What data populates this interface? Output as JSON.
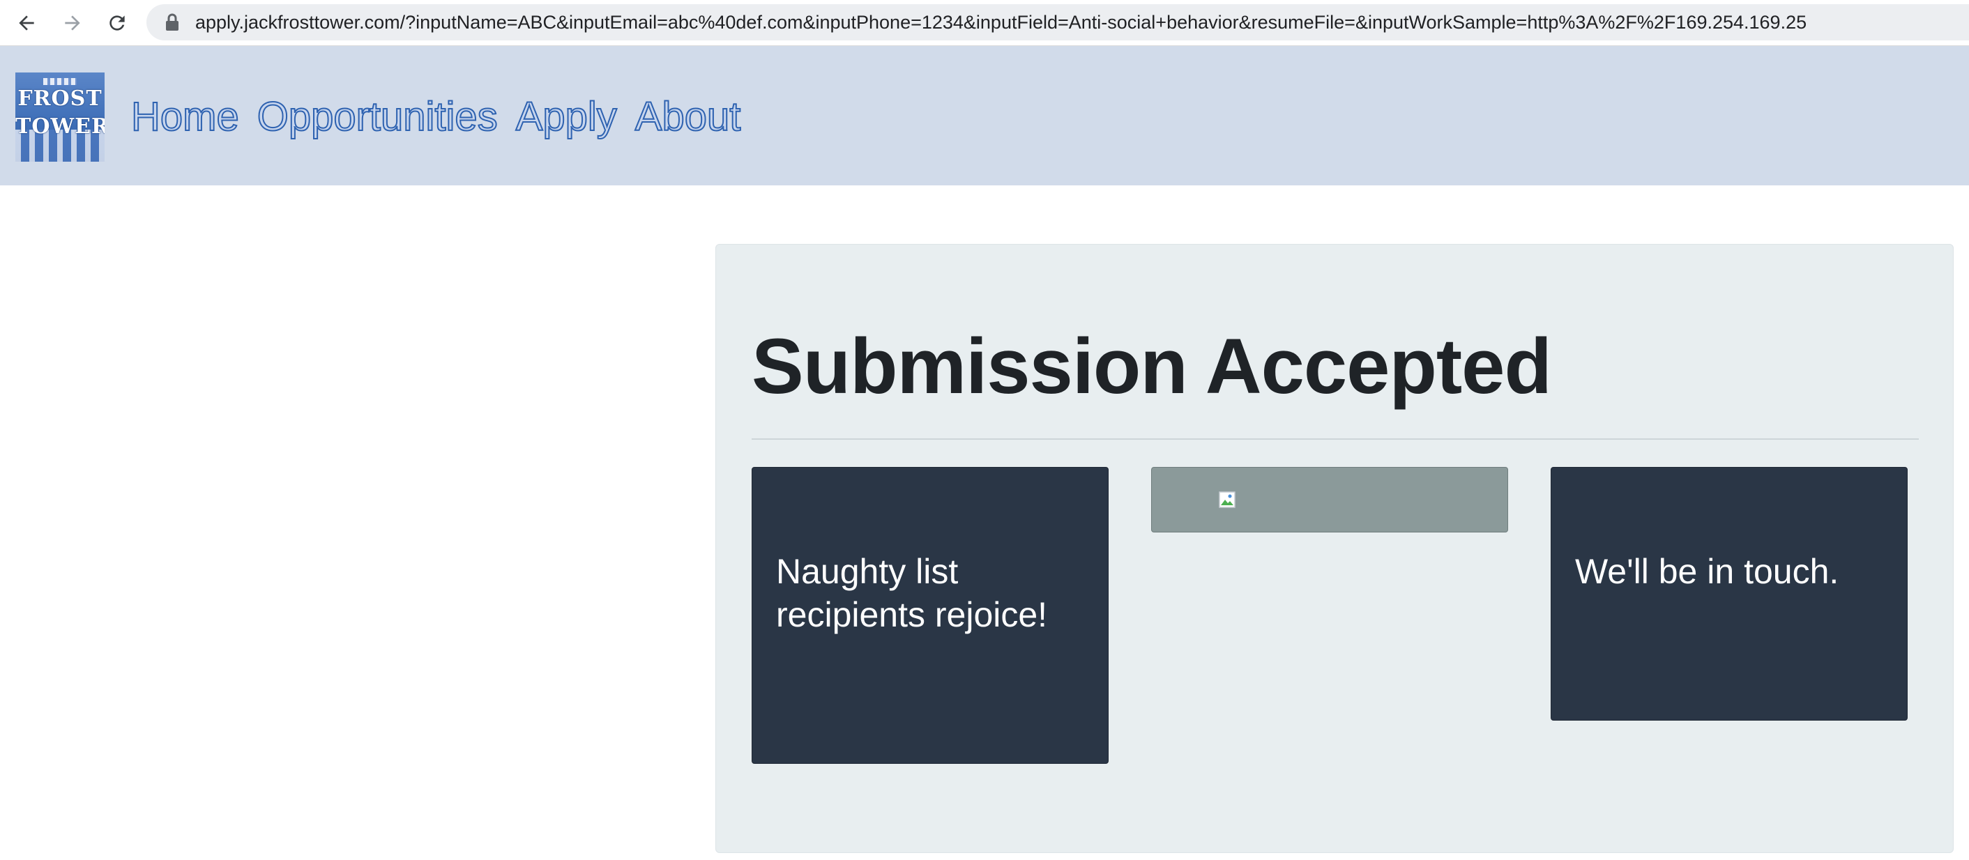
{
  "browser": {
    "url_host": "apply.jackfrosttower.com",
    "url_rest": "/?inputName=ABC&inputEmail=abc%40def.com&inputPhone=1234&inputField=Anti-social+behavior&resumeFile=&inputWorkSample=http%3A%2F%2F169.254.169.25",
    "icons": [
      "back-arrow-icon",
      "forward-arrow-icon",
      "reload-icon",
      "lock-icon"
    ]
  },
  "header": {
    "logo_lines": [
      "FROST",
      "TOWER"
    ],
    "nav": [
      {
        "label": "Home"
      },
      {
        "label": "Opportunities"
      },
      {
        "label": "Apply"
      },
      {
        "label": "About"
      }
    ],
    "background": "#d1dbea",
    "link_color": "#2e62b0"
  },
  "main": {
    "title": "Submission Accepted",
    "left_card_text": "Naughty list recipients rejoice!",
    "right_card_text": "We'll be in touch.",
    "card_color": "#2a3646",
    "image_box_color": "#8b9a9a"
  }
}
